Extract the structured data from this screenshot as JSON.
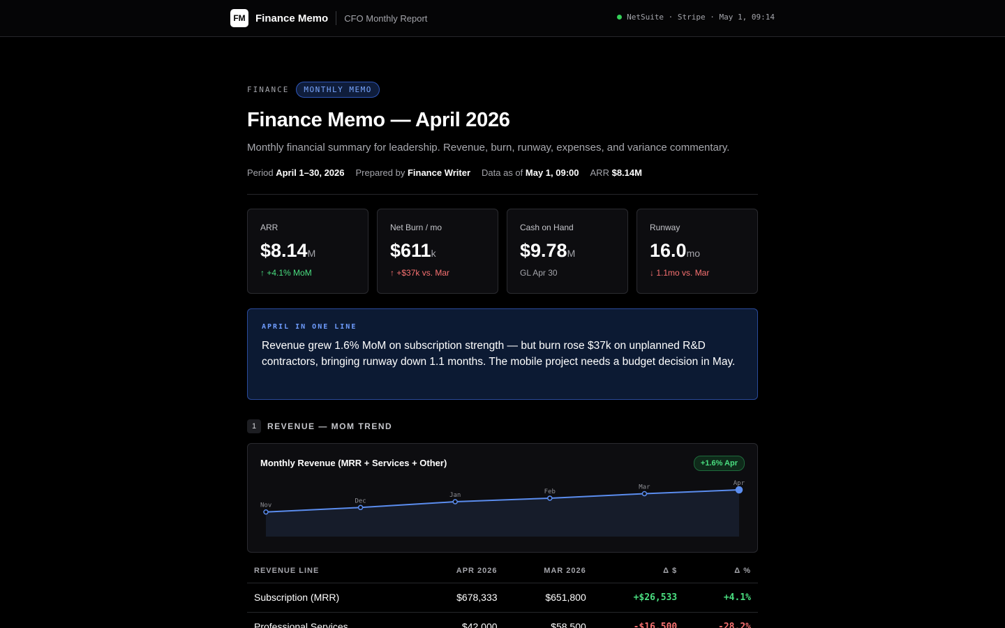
{
  "topbar": {
    "logo": "FM",
    "app_name": "Finance Memo",
    "report_name": "CFO Monthly Report",
    "sources": "NetSuite · Stripe · May 1, 09:14",
    "status_color": "#34d058"
  },
  "header": {
    "kicker": "FINANCE",
    "pill": "MONTHLY MEMO",
    "title": "Finance Memo — April 2026",
    "subtitle": "Monthly financial summary for leadership. Revenue, burn, runway, expenses, and variance commentary.",
    "meta": [
      {
        "label": "Period",
        "value": "April 1–30, 2026"
      },
      {
        "label": "Prepared by",
        "value": "Finance Writer"
      },
      {
        "label": "Data as of",
        "value": "May 1, 09:00"
      },
      {
        "label": "ARR",
        "value": "$8.14M"
      }
    ]
  },
  "kpis": [
    {
      "label": "ARR",
      "value": "$8.14",
      "unit": "M",
      "delta": "↑ +4.1% MoM",
      "tone": "good"
    },
    {
      "label": "Net Burn / mo",
      "value": "$611",
      "unit": "k",
      "delta": "↑ +$37k vs. Mar",
      "tone": "bad"
    },
    {
      "label": "Cash on Hand",
      "value": "$9.78",
      "unit": "M",
      "delta": "GL Apr 30",
      "tone": "neutral"
    },
    {
      "label": "Runway",
      "value": "16.0",
      "unit": "mo",
      "delta": "↓ 1.1mo vs. Mar",
      "tone": "bad"
    }
  ],
  "callout": {
    "label": "APRIL IN ONE LINE",
    "text": "Revenue grew 1.6% MoM on subscription strength — but burn rose $37k on unplanned R&D contractors, bringing runway down 1.1 months. The mobile project needs a budget decision in May."
  },
  "section1": {
    "number": "1",
    "title": "REVENUE — MOM TREND"
  },
  "chart_data": {
    "type": "area",
    "title": "Monthly Revenue (MRR + Services + Other)",
    "badge": "+1.6% Apr",
    "categories": [
      "Nov",
      "Dec",
      "Jan",
      "Feb",
      "Mar",
      "Apr"
    ],
    "series": [
      {
        "values": [
          0.31,
          0.45,
          0.63,
          0.74,
          0.88,
          1.0
        ]
      }
    ],
    "line_color": "#5b8def",
    "xlabel": "",
    "ylabel": ""
  },
  "revenue_table": {
    "headers": [
      "REVENUE LINE",
      "APR 2026",
      "MAR 2026",
      "Δ $",
      "Δ %"
    ],
    "rows": [
      {
        "line": "Subscription (MRR)",
        "apr": "$678,333",
        "mar": "$651,800",
        "d_usd": "+$26,533",
        "d_pct": "+4.1%",
        "tone": "good"
      },
      {
        "line": "Professional Services",
        "apr": "$42,000",
        "mar": "$58,500",
        "d_usd": "-$16,500",
        "d_pct": "-28.2%",
        "tone": "bad"
      }
    ]
  }
}
